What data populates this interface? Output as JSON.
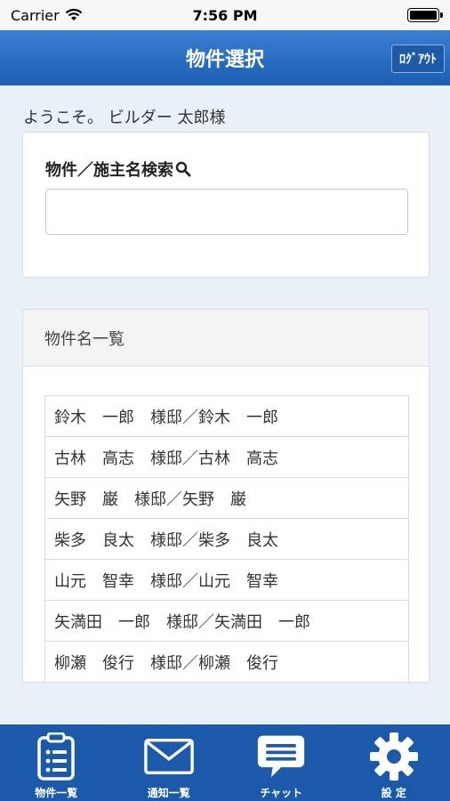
{
  "status_bar": {
    "carrier": "Carrier",
    "time": "7:56 PM"
  },
  "nav": {
    "title": "物件選択",
    "logout_label": "ﾛｸﾞｱｳﾄ"
  },
  "welcome_text": "ようこそ。 ビルダー 太郎様",
  "search": {
    "label": "物件／施主名検索",
    "value": "",
    "placeholder": ""
  },
  "list": {
    "header": "物件名一覧",
    "items": [
      "鈴木　一郎　様邸／鈴木　一郎",
      "古林　高志　様邸／古林　高志",
      "矢野　巌　様邸／矢野　巌",
      "柴多　良太　様邸／柴多　良太",
      "山元　智幸　様邸／山元　智幸",
      "矢満田　一郎　様邸／矢満田　一郎",
      "柳瀬　俊行　様邸／柳瀬　俊行"
    ]
  },
  "tabs": [
    {
      "label": "物件一覧",
      "icon": "clipboard-icon"
    },
    {
      "label": "通知一覧",
      "icon": "envelope-icon"
    },
    {
      "label": "チャット",
      "icon": "chat-bubble-icon"
    },
    {
      "label": "設 定",
      "icon": "gear-icon"
    }
  ]
}
